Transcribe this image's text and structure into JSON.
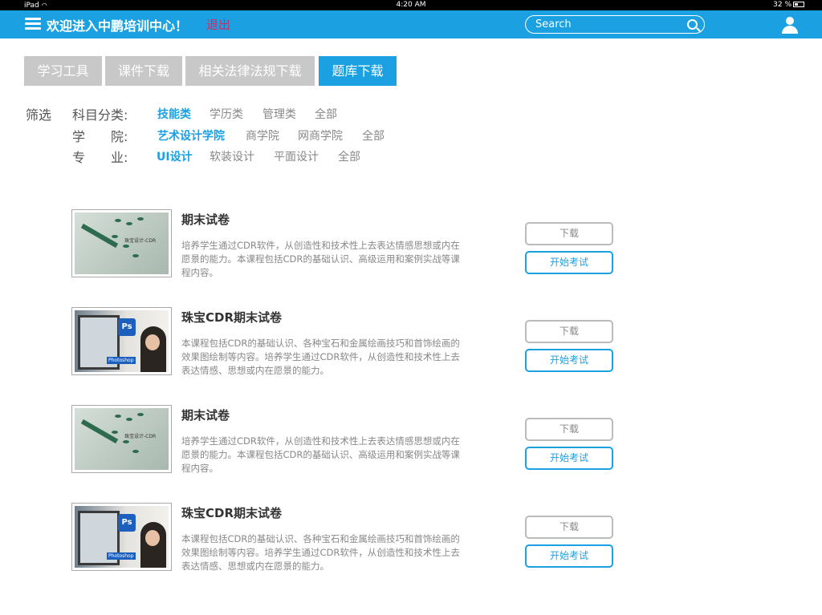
{
  "status": {
    "device": "iPad",
    "time": "4:20 AM",
    "battery": "32 %"
  },
  "header": {
    "welcome": "欢迎进入中鹏培训中心！",
    "logout": "退出",
    "search_placeholder": "Search"
  },
  "tabs": [
    {
      "label": "学习工具",
      "active": false
    },
    {
      "label": "课件下载",
      "active": false
    },
    {
      "label": "相关法律法规下载",
      "active": false
    },
    {
      "label": "题库下载",
      "active": true
    }
  ],
  "filter": {
    "title": "筛选",
    "rows": [
      {
        "label": "科目分类:",
        "options": [
          "技能类",
          "学历类",
          "管理类",
          "全部"
        ],
        "active": "技能类"
      },
      {
        "label": "学　　院:",
        "options": [
          "艺术设计学院",
          "商学院",
          "网商学院",
          "全部"
        ],
        "active": "艺术设计学院"
      },
      {
        "label": "专　　业:",
        "options": [
          "UI设计",
          "软装设计",
          "平面设计",
          "全部"
        ],
        "active": "UI设计"
      }
    ]
  },
  "courses": [
    {
      "title": "期末试卷",
      "thumb": "cdr",
      "desc": "培养学生通过CDR软件，从创造性和技术性上去表达情感思想或内在愿景的能力。本课程包括CDR的基础认识、高级运用和案例实战等课程内容。",
      "download": "下载",
      "start": "开始考试"
    },
    {
      "title": "珠宝CDR期末试卷",
      "thumb": "ps",
      "desc": "本课程包括CDR的基础认识、各种宝石和金属绘画技巧和首饰绘画的效果图绘制等内容。培养学生通过CDR软件，从创造性和技术性上去表达情感、思想或内在愿景的能力。",
      "download": "下载",
      "start": "开始考试"
    },
    {
      "title": "期末试卷",
      "thumb": "cdr",
      "desc": "培养学生通过CDR软件，从创造性和技术性上去表达情感思想或内在愿景的能力。本课程包括CDR的基础认识、高级运用和案例实战等课程内容。",
      "download": "下载",
      "start": "开始考试"
    },
    {
      "title": "珠宝CDR期末试卷",
      "thumb": "ps",
      "desc": "本课程包括CDR的基础认识、各种宝石和金属绘画技巧和首饰绘画的效果图绘制等内容。培养学生通过CDR软件，从创造性和技术性上去表达情感、思想或内在愿景的能力。",
      "download": "下载",
      "start": "开始考试"
    }
  ],
  "thumb_text": {
    "cdr": "珠宝设计-CDR",
    "ps_icon": "Ps",
    "ps_badge": "Photoshop"
  },
  "colors": {
    "accent": "#1ba1e2",
    "logout": "#e0245e",
    "tab_inactive": "#c8c8c8"
  }
}
